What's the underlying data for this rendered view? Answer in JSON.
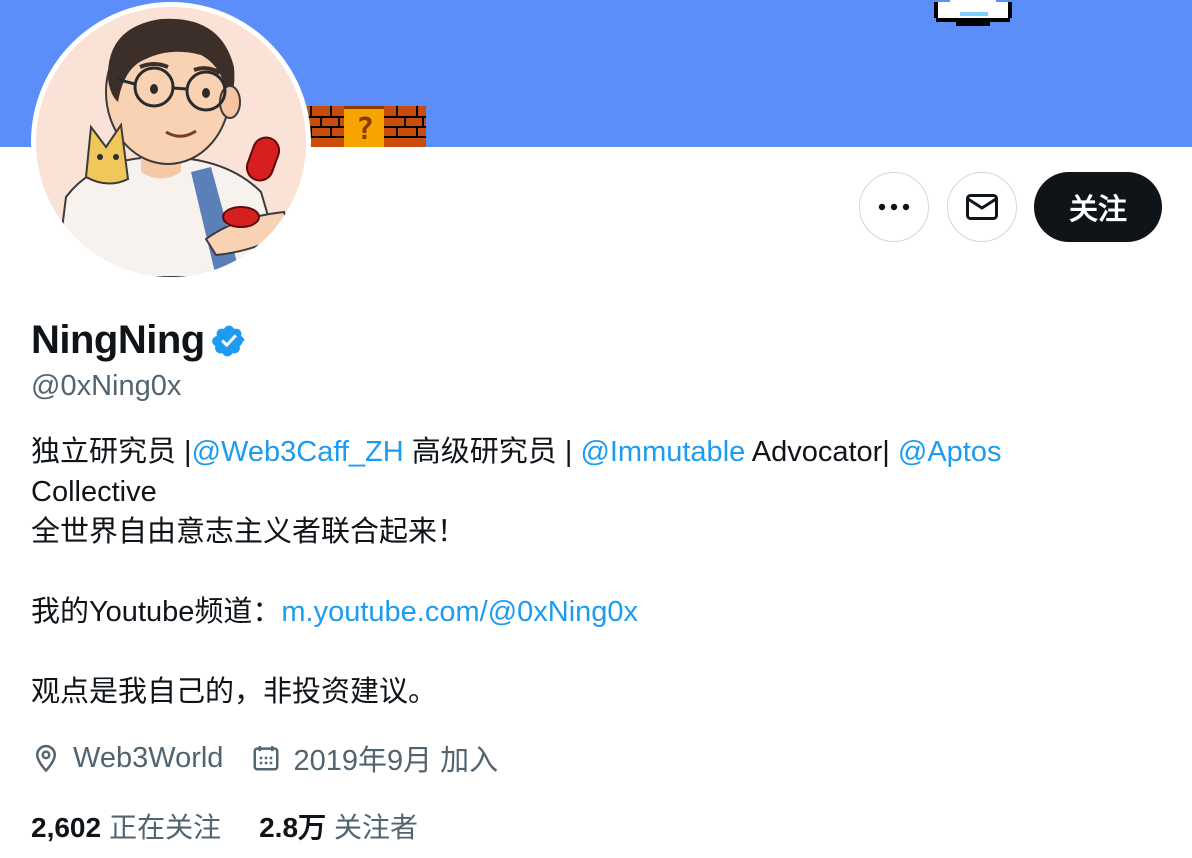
{
  "profile": {
    "display_name": "NingNing",
    "handle": "@0xNing0x",
    "verified_icon": "verified-badge-icon"
  },
  "actions": {
    "more_icon": "more-horizontal-icon",
    "message_icon": "mail-icon",
    "follow_label": "关注"
  },
  "bio": {
    "line1": [
      {
        "text": "独立研究员 |",
        "link": false
      },
      {
        "text": "@Web3Caff_ZH",
        "link": true
      },
      {
        "text": " 高级研究员 | ",
        "link": false
      },
      {
        "text": "@Immutable",
        "link": true
      },
      {
        "text": " Advocator| ",
        "link": false
      },
      {
        "text": "@Aptos",
        "link": true
      }
    ],
    "line2": "Collective",
    "line3": "全世界自由意志主义者联合起来！",
    "youtube_prefix": "我的Youtube频道：",
    "youtube_link": "m.youtube.com/@0xNing0x",
    "disclaimer": "观点是我自己的，非投资建议。"
  },
  "meta": {
    "location_icon": "location-pin-icon",
    "location": "Web3World",
    "joined_icon": "calendar-icon",
    "joined": "2019年9月 加入"
  },
  "stats": {
    "following_count": "2,602",
    "following_label": "正在关注",
    "followers_count": "2.8万",
    "followers_label": "关注者"
  },
  "colors": {
    "banner": "#5b8ef8",
    "link": "#1d9bf0",
    "verified": "#1d9bf0",
    "primary_text": "#0f1419",
    "secondary_text": "#536471",
    "follow_button": "#0f1419"
  }
}
